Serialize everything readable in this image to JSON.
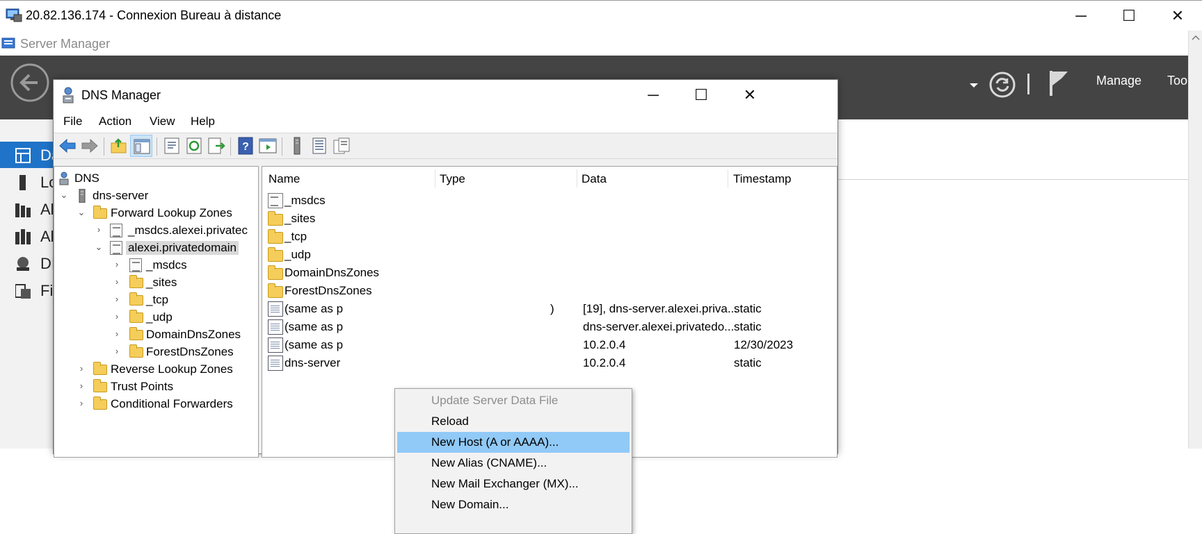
{
  "rdp": {
    "title": "20.82.136.174 - Connexion Bureau à distance",
    "minimize": "─",
    "maximize": "☐",
    "close": "✕"
  },
  "server_manager": {
    "title": "Server Manager",
    "header": {
      "manage": "Manage",
      "tools": "Too"
    },
    "sidebar": [
      {
        "label": "Da",
        "icon": "dashboard-icon"
      },
      {
        "label": "Lo",
        "icon": "local-server-icon"
      },
      {
        "label": "Al",
        "icon": "all-servers-icon"
      },
      {
        "label": "Al",
        "icon": "ad-icon"
      },
      {
        "label": "DI",
        "icon": "dns-icon"
      },
      {
        "label": "Fi",
        "icon": "file-services-icon"
      }
    ]
  },
  "dns_manager": {
    "title": "DNS Manager",
    "menu": [
      "File",
      "Action",
      "View",
      "Help"
    ],
    "tree": {
      "root": "DNS",
      "server": "dns-server",
      "forward": "Forward Lookup Zones",
      "msdcs_zone": "_msdcs.alexei.privatec",
      "main_zone": "alexei.privatedomain",
      "sub": [
        "_msdcs",
        "_sites",
        "_tcp",
        "_udp",
        "DomainDnsZones",
        "ForestDnsZones"
      ],
      "reverse": "Reverse Lookup Zones",
      "trust": "Trust Points",
      "conditional": "Conditional Forwarders"
    },
    "columns": [
      "Name",
      "Type",
      "Data",
      "Timestamp"
    ],
    "rows": [
      {
        "name": "_msdcs",
        "type": "",
        "data": "",
        "timestamp": "",
        "icon": "zone"
      },
      {
        "name": "_sites",
        "type": "",
        "data": "",
        "timestamp": "",
        "icon": "folder"
      },
      {
        "name": "_tcp",
        "type": "",
        "data": "",
        "timestamp": "",
        "icon": "folder"
      },
      {
        "name": "_udp",
        "type": "",
        "data": "",
        "timestamp": "",
        "icon": "folder"
      },
      {
        "name": "DomainDnsZones",
        "type": "",
        "data": "",
        "timestamp": "",
        "icon": "folder"
      },
      {
        "name": "ForestDnsZones",
        "type": "",
        "data": "",
        "timestamp": "",
        "icon": "folder"
      },
      {
        "name": "(same as p",
        "type": ")",
        "data": "[19], dns-server.alexei.priva...",
        "timestamp": "static",
        "icon": "record"
      },
      {
        "name": "(same as p",
        "type": "",
        "data": "dns-server.alexei.privatedo...",
        "timestamp": "static",
        "icon": "record"
      },
      {
        "name": "(same as p",
        "type": "",
        "data": "10.2.0.4",
        "timestamp": "12/30/2023",
        "icon": "record"
      },
      {
        "name": "dns-server",
        "type": "",
        "data": "10.2.0.4",
        "timestamp": "static",
        "icon": "record"
      }
    ],
    "context_menu": [
      {
        "label": "Update Server Data File",
        "state": "disabled"
      },
      {
        "label": "Reload",
        "state": "normal"
      },
      {
        "label": "New Host (A or AAAA)...",
        "state": "hover"
      },
      {
        "label": "New Alias (CNAME)...",
        "state": "normal"
      },
      {
        "label": "New Mail Exchanger (MX)...",
        "state": "normal"
      },
      {
        "label": "New Domain...",
        "state": "normal"
      }
    ]
  },
  "colors": {
    "sm_header": "#444444",
    "selection": "#91c9f7",
    "folder": "#f5cd5a"
  }
}
